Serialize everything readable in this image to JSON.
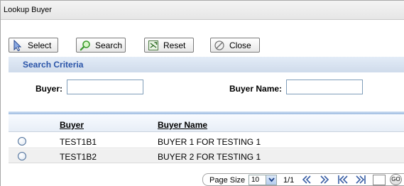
{
  "window": {
    "title": "Lookup Buyer"
  },
  "toolbar": {
    "select_label": "Select",
    "search_label": "Search",
    "reset_label": "Reset",
    "close_label": "Close"
  },
  "criteria": {
    "title": "Search Criteria",
    "buyer_label": "Buyer:",
    "buyer_value": "",
    "buyer_name_label": "Buyer Name:",
    "buyer_name_value": ""
  },
  "grid": {
    "columns": [
      "Buyer",
      "Buyer Name"
    ],
    "rows": [
      {
        "buyer": "TEST1B1",
        "buyer_name": "BUYER 1 FOR TESTING 1"
      },
      {
        "buyer": "TEST1B2",
        "buyer_name": "BUYER 2 FOR TESTING 1"
      }
    ]
  },
  "pager": {
    "page_size_label": "Page Size",
    "page_size_value": "10",
    "page_info": "1/1",
    "go_label": "GO",
    "page_input_value": ""
  },
  "colors": {
    "accent": "#2a54a8",
    "criteria_bg": "#d6e1ef",
    "nav_arrow": "#3a5fa5"
  }
}
